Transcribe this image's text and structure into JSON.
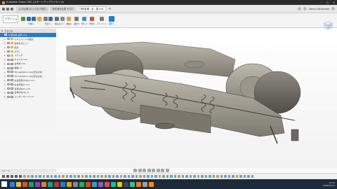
{
  "window": {
    "title": "Autodesk Fusion 360 (スタートアップライセンス)"
  },
  "tabs": [
    {
      "label": "ムOE台車(ボルスタ)下回り"
    },
    {
      "label": "作成済み台車 その2"
    },
    {
      "label": "TR寝台車 - 台 - 部 v34",
      "active": true
    }
  ],
  "user": {
    "name": "Tokuro Yamamoto"
  },
  "toolbar": {
    "workspace": "デザイン",
    "groups": [
      {
        "label": "作成 ▾",
        "icons": [
          "sketch-icon",
          "box-icon",
          "cylinder-icon",
          "star-icon"
        ],
        "colors": [
          "#5a8f3e",
          "#2e6db0",
          "#2e6db0",
          "#ff9f2e"
        ]
      },
      {
        "label": "修正 ▾",
        "icons": [
          "press-pull-icon",
          "fillet-icon"
        ],
        "colors": [
          "#7a7a7a",
          "#2e6db0"
        ]
      },
      {
        "label": "組み立て ▾",
        "icons": [
          "new-component-icon",
          "joint-icon"
        ],
        "colors": [
          "#6d6d6d",
          "#7d8a9a"
        ]
      },
      {
        "label": "構築 ▾",
        "icons": [
          "plane-icon"
        ],
        "colors": [
          "#e0a53a"
        ]
      },
      {
        "label": "検査 ▾",
        "icons": [
          "measure-icon"
        ],
        "colors": [
          "#777777"
        ]
      },
      {
        "label": "挿入 ▾",
        "icons": [
          "insert-image-icon"
        ],
        "colors": [
          "#3a8fd5"
        ]
      },
      {
        "label": "作成 ▾",
        "icons": [
          "make-3dprint-icon"
        ],
        "colors": [
          "#d04848"
        ]
      },
      {
        "label": "アドイン ▾",
        "icons": [
          "addin-icon"
        ],
        "colors": [
          "#7b7b7b"
        ]
      },
      {
        "label": "選択 ▾",
        "icons": [
          "select-icon"
        ],
        "colors": [
          "#1e7bd8"
        ],
        "active": true
      }
    ]
  },
  "browser": {
    "header": "ブラウザ",
    "items": [
      {
        "label": "TR寝台車 台車 v34",
        "type": "root",
        "indent": 0
      },
      {
        "label": "ドキュメントの設定",
        "type": "folder",
        "indent": 1
      },
      {
        "label": "名前付きビュー",
        "type": "folder",
        "indent": 1
      },
      {
        "label": "原点",
        "type": "folder",
        "indent": 1
      },
      {
        "label": "ボディ",
        "type": "folder",
        "indent": 1
      },
      {
        "label": "スケッチ",
        "type": "folder",
        "indent": 1
      },
      {
        "label": "ボルスタ v11",
        "type": "component",
        "indent": 1
      },
      {
        "label": "台車枠 v12",
        "type": "component",
        "indent": 1
      },
      {
        "label": "軸箱 v7",
        "type": "component",
        "indent": 1
      },
      {
        "label": "TR Gestation ops(空気ばね)",
        "type": "component",
        "indent": 1
      },
      {
        "label": "TR Gestation ops(空気ばね)",
        "type": "component",
        "indent": 1
      },
      {
        "label": "左台車受け(P/L) v11",
        "type": "component",
        "indent": 1
      },
      {
        "label": "右台車受け v11",
        "type": "component",
        "indent": 1
      },
      {
        "label": "台車ばね(L) v12",
        "type": "component",
        "indent": 1
      },
      {
        "label": "台車ばね(R) v1",
        "type": "component",
        "indent": 1
      },
      {
        "label": "コンポーネント1 v1",
        "type": "component",
        "indent": 1
      }
    ]
  },
  "comments": {
    "label": "コメント"
  },
  "system": {
    "time": "10:43",
    "date": "2018/05/24"
  }
}
